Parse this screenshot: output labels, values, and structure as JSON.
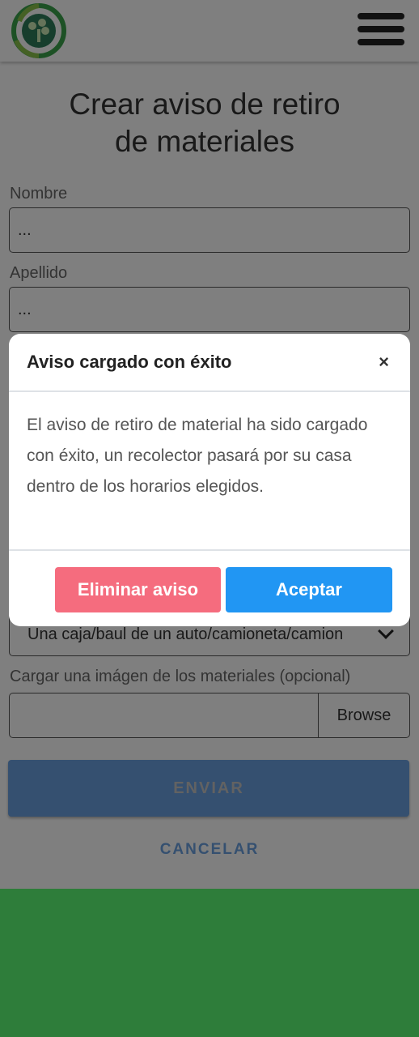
{
  "header": {
    "logo_icon": "recycling-tree-logo",
    "menu_icon": "hamburger-menu-icon"
  },
  "form": {
    "title_line1": "Crear aviso de retiro",
    "title_line2": "de materiales",
    "nombre_label": "Nombre",
    "nombre_value": "...",
    "apellido_label": "Apellido",
    "apellido_value": "...",
    "container_select_value": "Una caja/baul de un auto/camioneta/camion",
    "image_label": "Cargar una imágen de los materiales (opcional)",
    "browse_label": "Browse",
    "send_label": "ENVIAR",
    "cancel_label": "CANCELAR"
  },
  "modal": {
    "title": "Aviso cargado con éxito",
    "close_label": "×",
    "body": "El aviso de retiro de material ha sido cargado con éxito, un recolector pasará por su casa dentro de los horarios elegidos.",
    "delete_label": "Eliminar aviso",
    "accept_label": "Aceptar"
  },
  "colors": {
    "footer": "#2e7d3a",
    "accept": "#2196f3",
    "delete": "#f56c7e",
    "send": "#6aa0e0"
  }
}
